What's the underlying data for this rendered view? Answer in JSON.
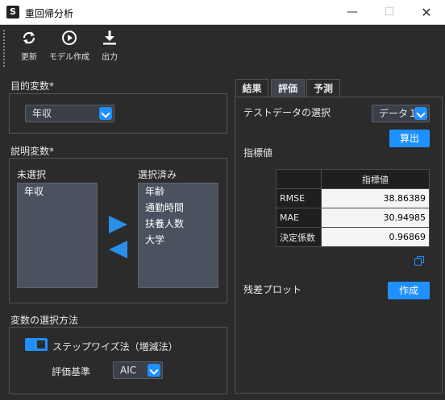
{
  "window": {
    "app_icon_letter": "S",
    "title": "重回帰分析",
    "minimize_glyph": "—",
    "maximize_glyph": "☐",
    "close_glyph": "✕"
  },
  "toolbar": {
    "update_label": "更新",
    "create_model_label": "モデル作成",
    "export_label": "出力"
  },
  "target": {
    "section_title": "目的変数*",
    "selected": "年収"
  },
  "explanatory": {
    "section_title": "説明変数*",
    "unselected_label": "未選択",
    "selected_label": "選択済み",
    "unselected_items": [
      "年収"
    ],
    "selected_items": [
      "年齢",
      "通勤時間",
      "扶養人数",
      "大学"
    ]
  },
  "selection_method": {
    "section_title": "変数の選択方法",
    "stepwise_label": "ステップワイズ法（増減法）",
    "stepwise_on": true,
    "criterion_label": "評価基準",
    "criterion_value": "AIC"
  },
  "tabs": [
    {
      "label": "結果",
      "active": false
    },
    {
      "label": "評価",
      "active": true
    },
    {
      "label": "予測",
      "active": false
    }
  ],
  "evaluation": {
    "test_data_label": "テストデータの選択",
    "test_data_value": "データ１",
    "calc_button": "算出",
    "metrics_label": "指標値",
    "table_header": "指標値",
    "rows": [
      {
        "name": "RMSE",
        "value": "38.86389"
      },
      {
        "name": "MAE",
        "value": "30.94985"
      },
      {
        "name": "決定係数",
        "value": "0.96869"
      }
    ],
    "residual_plot_label": "残差プロット",
    "create_button": "作成"
  },
  "colors": {
    "accent": "#1e90ff",
    "background": "#2b2b2b",
    "list_background": "#4a5260"
  },
  "icons": [
    "refresh-icon",
    "play-circle-icon",
    "download-icon",
    "chevron-down-icon",
    "arrow-right-icon",
    "arrow-left-icon",
    "copy-icon"
  ]
}
